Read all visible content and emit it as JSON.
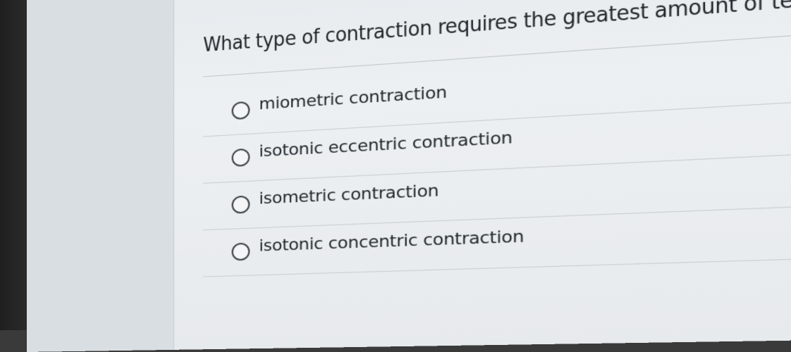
{
  "question": {
    "text": "What type of contraction requires the greatest amount of tension?"
  },
  "options": [
    {
      "label": "miometric contraction",
      "selected": false
    },
    {
      "label": "isotonic eccentric contraction",
      "selected": false
    },
    {
      "label": "isometric contraction",
      "selected": false
    },
    {
      "label": "isotonic concentric contraction",
      "selected": false
    }
  ]
}
